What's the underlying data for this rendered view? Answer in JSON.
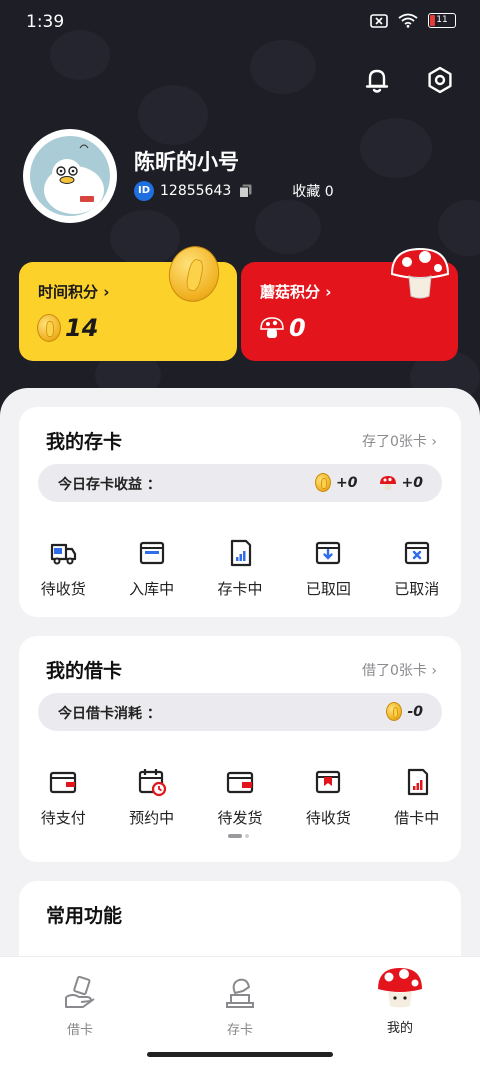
{
  "status_bar": {
    "time": "1:39",
    "battery": "11"
  },
  "profile": {
    "nickname": "陈昕的小号",
    "id_badge": "ID",
    "id_number": "12855643",
    "favorites": "收藏 0"
  },
  "points": {
    "time_label": "时间积分",
    "time_value": "14",
    "mushroom_label": "蘑菇积分",
    "mushroom_value": "0"
  },
  "deposit": {
    "title": "我的存卡",
    "link": "存了0张卡",
    "today_label": "今日存卡收益 ：",
    "coin_value": "+0",
    "mushroom_value": "+0",
    "items": [
      {
        "label": "待收货",
        "icon": "truck-icon"
      },
      {
        "label": "入库中",
        "icon": "box-inbound-icon"
      },
      {
        "label": "存卡中",
        "icon": "card-signal-icon"
      },
      {
        "label": "已取回",
        "icon": "box-retrieved-icon"
      },
      {
        "label": "已取消",
        "icon": "box-cancelled-icon"
      }
    ]
  },
  "borrow": {
    "title": "我的借卡",
    "link": "借了0张卡",
    "today_label": "今日借卡消耗 ：",
    "coin_value": "-0",
    "items": [
      {
        "label": "待支付",
        "icon": "wallet-icon"
      },
      {
        "label": "预约中",
        "icon": "calendar-clock-icon"
      },
      {
        "label": "待发货",
        "icon": "wallet-ship-icon"
      },
      {
        "label": "待收货",
        "icon": "package-icon"
      },
      {
        "label": "借卡中",
        "icon": "card-signal-icon"
      }
    ]
  },
  "common": {
    "title": "常用功能"
  },
  "tabbar": {
    "items": [
      {
        "label": "借卡",
        "icon": "borrow-hand-icon"
      },
      {
        "label": "存卡",
        "icon": "deposit-icon"
      },
      {
        "label": "我的",
        "icon": "mushroom-avatar-icon"
      }
    ],
    "active": 2
  },
  "colors": {
    "hero_bg": "#1d1e26",
    "time_card": "#fcd12a",
    "mushroom_card": "#e4141c",
    "id_badge": "#1f6fe0"
  }
}
